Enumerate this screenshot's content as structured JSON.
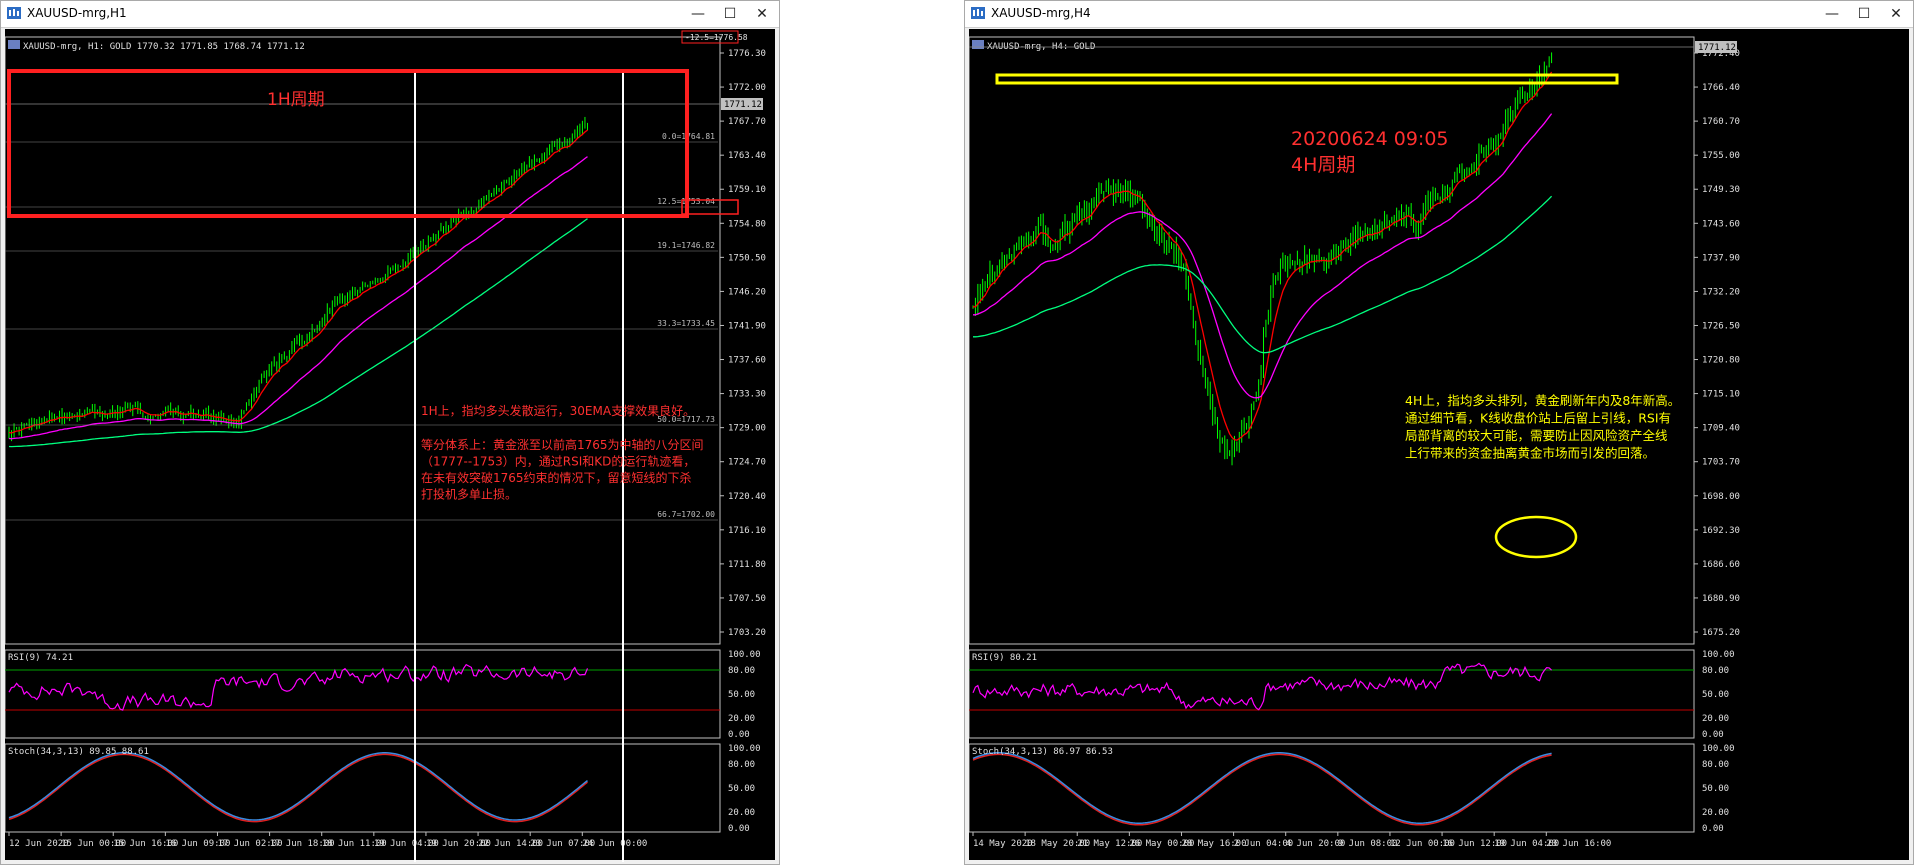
{
  "windows": [
    {
      "title": "XAUUSD-mrg,H1",
      "header": "XAUUSD-mrg, H1:  GOLD   1770.32  1771.85  1768.74  1771.12",
      "price_label": "1771.12",
      "top_marker": "-12.5=1776.58",
      "period_label": "1H周期",
      "fib_levels": [
        "0.0=1764.81",
        "12.5=1753.04",
        "19.1=1746.82",
        "33.3=1733.45",
        "50.0=1717.73",
        "66.7=1702.00"
      ],
      "price_axis": [
        "1776.30",
        "1772.00",
        "1767.70",
        "1763.40",
        "1759.10",
        "1754.80",
        "1750.50",
        "1746.20",
        "1741.90",
        "1737.60",
        "1733.30",
        "1729.00",
        "1724.70",
        "1720.40",
        "1716.10",
        "1711.80",
        "1707.50",
        "1703.20"
      ],
      "annotation_1": "1H上，指均多头发散运行，30EMA支撑效果良好。",
      "annotation_2": [
        "等分体系上：黄金涨至以前高1765为中轴的八分区间",
        "（1777--1753）内，通过RSI和KD的运行轨迹看，",
        "在未有效突破1765约束的情况下，留意短线的下杀",
        "打投机多单止损。"
      ],
      "rsi_label": "RSI(9) 74.21",
      "stoch_label": "Stoch(34,3,13) 89.85 88.61",
      "osc_axis": [
        "100.00",
        "80.00",
        "50.00",
        "20.00",
        "0.00"
      ],
      "dates": [
        "12 Jun 2020",
        "15 Jun 00:00",
        "15 Jun 16:00",
        "16 Jun 09:00",
        "17 Jun 02:00",
        "17 Jun 18:00",
        "18 Jun 11:00",
        "19 Jun 04:00",
        "19 Jun 20:00",
        "22 Jun 14:00",
        "23 Jun 07:00",
        "24 Jun 00:00"
      ]
    },
    {
      "title": "XAUUSD-mrg,H4",
      "header": "XAUUSD-mrg, H4:  GOLD",
      "price_label": "1771.12",
      "period_label_1": "20200624 09:05",
      "period_label_2": "4H周期",
      "price_axis": [
        "1772.40",
        "1766.40",
        "1760.70",
        "1755.00",
        "1749.30",
        "1743.60",
        "1737.90",
        "1732.20",
        "1726.50",
        "1720.80",
        "1715.10",
        "1709.40",
        "1703.70",
        "1698.00",
        "1692.30",
        "1686.60",
        "1680.90",
        "1675.20"
      ],
      "annotation": [
        "4H上，指均多头排列，黄金刷新年内及8年新高。",
        "通过细节看，K线收盘价站上后留上引线，RSI有",
        "局部背离的较大可能，需要防止因风险资产全线",
        "上行带来的资金抽离黄金市场而引发的回落。"
      ],
      "rsi_label": "RSI(9) 80.21",
      "stoch_label": "Stoch(34,3,13) 86.97 86.53",
      "osc_axis": [
        "100.00",
        "80.00",
        "50.00",
        "20.00",
        "0.00"
      ],
      "dates": [
        "14 May 2020",
        "18 May 20:00",
        "21 May 12:00",
        "26 May 00:00",
        "28 May 16:00",
        "2 Jun 04:00",
        "4 Jun 20:00",
        "9 Jun 08:00",
        "12 Jun 00:00",
        "16 Jun 12:00",
        "19 Jun 04:00",
        "23 Jun 16:00"
      ]
    }
  ],
  "colors": {
    "bull": "#00ff00",
    "ema_fast": "#ff0000",
    "ema_mid": "#ff00ff",
    "ema_slow": "#00ff7f",
    "highlight_box": "#ff2020",
    "yellow_box": "#ffff00",
    "annot_red": "#ff3030",
    "annot_yellow": "#ffff00"
  }
}
